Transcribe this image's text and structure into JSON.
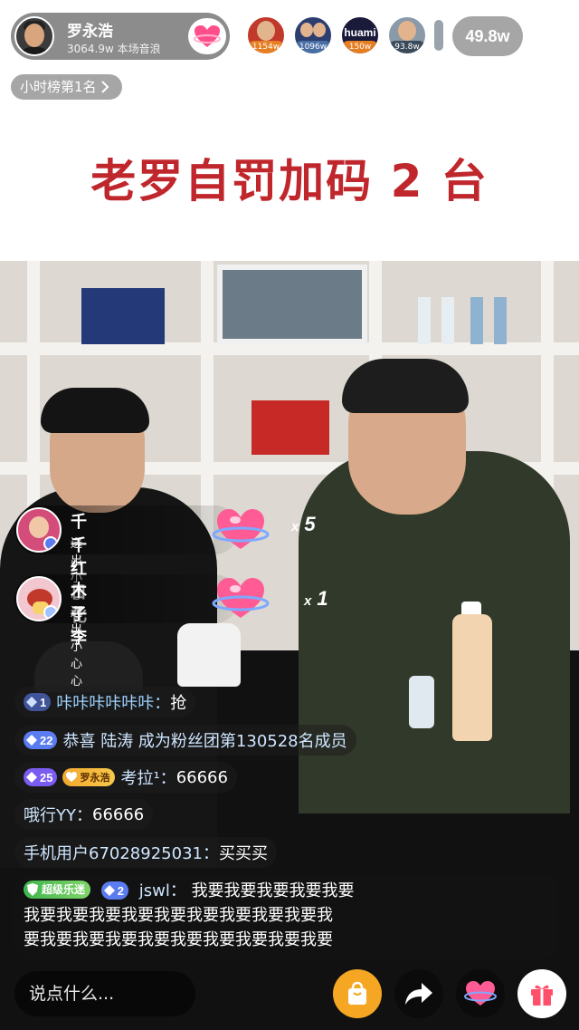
{
  "banner": {
    "title": "老罗自罚加码 2 台",
    "title_color": "#c0272d"
  },
  "anchor": {
    "name": "罗永浩",
    "stat": "3064.9w 本场音浪",
    "follow_icon": "heart-icon"
  },
  "top_viewers": [
    {
      "badge": "1154w",
      "color": "#c0392b"
    },
    {
      "badge": "1096w",
      "color": "#2c3e70"
    },
    {
      "badge": "150w",
      "color": "#1a1a3a",
      "text": "huami"
    },
    {
      "badge": "93.8w",
      "color": "#3a4a5a"
    }
  ],
  "audience_count": "49.8w",
  "rank_pill": {
    "label": "小时榜第1名"
  },
  "gifts": [
    {
      "name": "千千红日化",
      "action": "送出小心心",
      "count": "5"
    },
    {
      "name": "木子李",
      "action": "送出小心心",
      "count": "1"
    }
  ],
  "chat": [
    {
      "level": "1",
      "user": "咔咔咔咔咔咔：",
      "msg": "抢"
    },
    {
      "level": "22",
      "msg": "恭喜 陆涛 成为粉丝团第130528名成员"
    },
    {
      "level": "25",
      "fan_badge": "罗永浩",
      "user": "考拉¹：",
      "msg": "66666"
    },
    {
      "user": "哦行YY：",
      "msg": "66666"
    },
    {
      "user": "手机用户67028925031：",
      "msg": "买买买"
    }
  ],
  "big_message": {
    "super_badge": "超级乐迷",
    "level": "2",
    "user": "jswl：",
    "line1": "我要我要我要我要我要",
    "line2": "我要我要我要我要我要我要我要我要我要我",
    "line3": "要我要我要我要我要我要我要我要我要我要"
  },
  "bottom_bar": {
    "input_placeholder": "说点什么...",
    "shop_icon": "shopping-bag-icon",
    "share_icon": "share-arrow-icon",
    "like_icon": "heart-icon",
    "gift_icon": "gift-icon"
  },
  "colors": {
    "level_blue": "#5b7cf0",
    "level_purple": "#7b5cf0",
    "heart_pink": "#ff4f8a"
  }
}
